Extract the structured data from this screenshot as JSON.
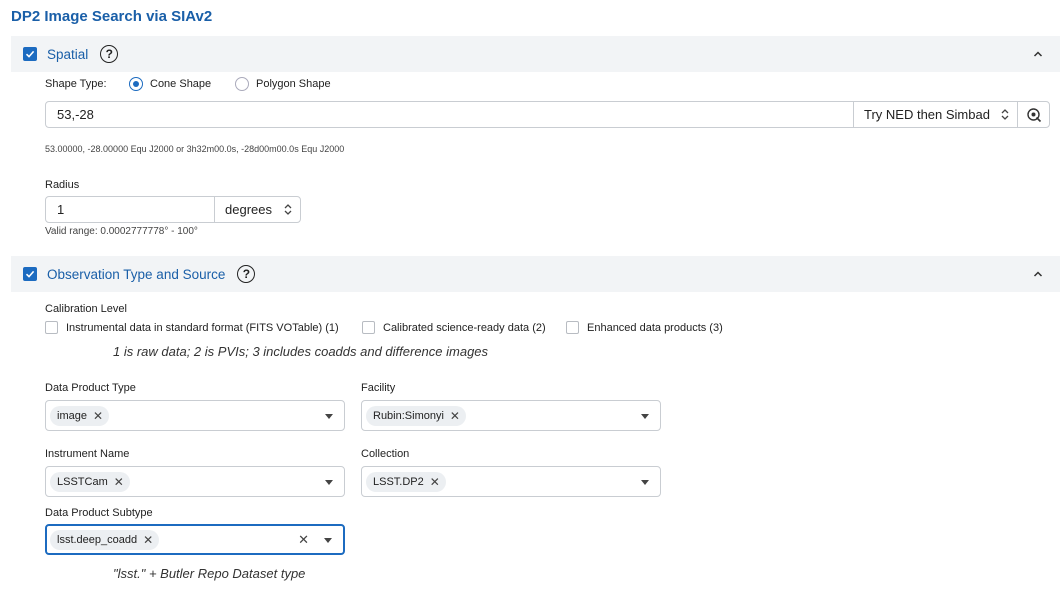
{
  "page": {
    "title": "DP2 Image Search via SIAv2"
  },
  "spatial": {
    "title": "Spatial",
    "help": "?",
    "shape_type_label": "Shape Type:",
    "shape_options": [
      {
        "label": "Cone Shape",
        "selected": true
      },
      {
        "label": "Polygon Shape",
        "selected": false
      }
    ],
    "position_value": "53,-28",
    "resolver_value": "Try NED then Simbad",
    "coord_info": "53.00000, -28.00000  Equ J2000    or    3h32m00.0s, -28d00m00.0s  Equ J2000",
    "radius_label": "Radius",
    "radius_value": "1",
    "radius_unit": "degrees",
    "radius_range": "Valid range: 0.0002777778° - 100°"
  },
  "observation": {
    "title": "Observation Type and Source",
    "help": "?",
    "calibration_label": "Calibration Level",
    "calibration_options": [
      "Instrumental data in standard format (FITS VOTable) (1)",
      "Calibrated science-ready data (2)",
      "Enhanced data products (3)"
    ],
    "calibration_hint": "1 is raw data; 2 is PVIs; 3 includes coadds and difference images",
    "data_product_type": {
      "label": "Data Product Type",
      "chip": "image"
    },
    "facility": {
      "label": "Facility",
      "chip": "Rubin:Simonyi"
    },
    "instrument_name": {
      "label": "Instrument Name",
      "chip": "LSSTCam"
    },
    "collection": {
      "label": "Collection",
      "chip": "LSST.DP2"
    },
    "data_product_subtype": {
      "label": "Data Product Subtype",
      "chip": "lsst.deep_coadd"
    },
    "subtype_hint": "\"lsst.\" + Butler Repo Dataset type"
  },
  "colors": {
    "accent": "#1c6bc0",
    "title": "#1a5fa8",
    "header_bg": "#f2f4f6"
  }
}
